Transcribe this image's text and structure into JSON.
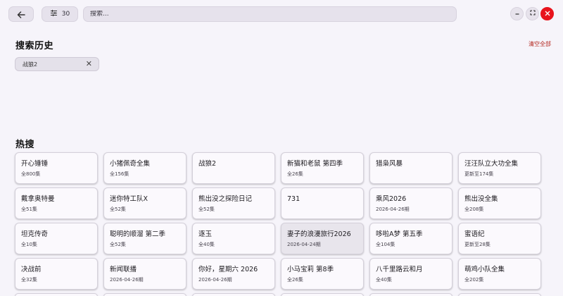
{
  "toolbar": {
    "back_icon": "arrow-left-icon",
    "filter_icon": "filter-lines-icon",
    "filter_count": "30",
    "search_placeholder": "搜索...",
    "minimize_icon": "minimize-icon",
    "maximize_icon": "maximize-icon",
    "close_icon": "close-icon"
  },
  "history": {
    "title": "搜索历史",
    "clear_all": "清空全部",
    "items": [
      {
        "label": "战狼2"
      }
    ]
  },
  "hot": {
    "title": "热搜",
    "items": [
      {
        "title": "开心锤锤",
        "sub": "全800集"
      },
      {
        "title": "小猪佩奇全集",
        "sub": "全156集"
      },
      {
        "title": "战狼2",
        "sub": ""
      },
      {
        "title": "新猫和老鼠 第四季",
        "sub": "全26集"
      },
      {
        "title": "猎枭风暴",
        "sub": ""
      },
      {
        "title": "汪汪队立大功全集",
        "sub": "更新至174集"
      },
      {
        "title": "戴拿奥特曼",
        "sub": "全51集"
      },
      {
        "title": "迷你特工队X",
        "sub": "全52集"
      },
      {
        "title": "熊出没之探险日记",
        "sub": "全52集"
      },
      {
        "title": "731",
        "sub": ""
      },
      {
        "title": "乘风2026",
        "sub": "2026-04-26期"
      },
      {
        "title": "熊出没全集",
        "sub": "全208集"
      },
      {
        "title": "坦克传奇",
        "sub": "全10集"
      },
      {
        "title": "聪明的顺溜 第二季",
        "sub": "全52集"
      },
      {
        "title": "逐玉",
        "sub": "全40集"
      },
      {
        "title": "妻子的浪漫旅行2026",
        "sub": "2026-04-24期"
      },
      {
        "title": "哆啦A梦 第五季",
        "sub": "全104集"
      },
      {
        "title": "蜜语纪",
        "sub": "更新至28集"
      },
      {
        "title": "决战前",
        "sub": "全32集"
      },
      {
        "title": "新闻联播",
        "sub": "2026-04-26期"
      },
      {
        "title": "你好，星期六 2026",
        "sub": "2026-04-26期"
      },
      {
        "title": "小马宝莉 第8季",
        "sub": "全26集"
      },
      {
        "title": "八千里路云和月",
        "sub": "全40集"
      },
      {
        "title": "萌鸡小队全集",
        "sub": "全202集"
      }
    ],
    "highlighted_index": 15
  },
  "colors": {
    "background": "#f6f4fa",
    "accent_red": "#e8131c",
    "clear_text": "#b3261e"
  }
}
